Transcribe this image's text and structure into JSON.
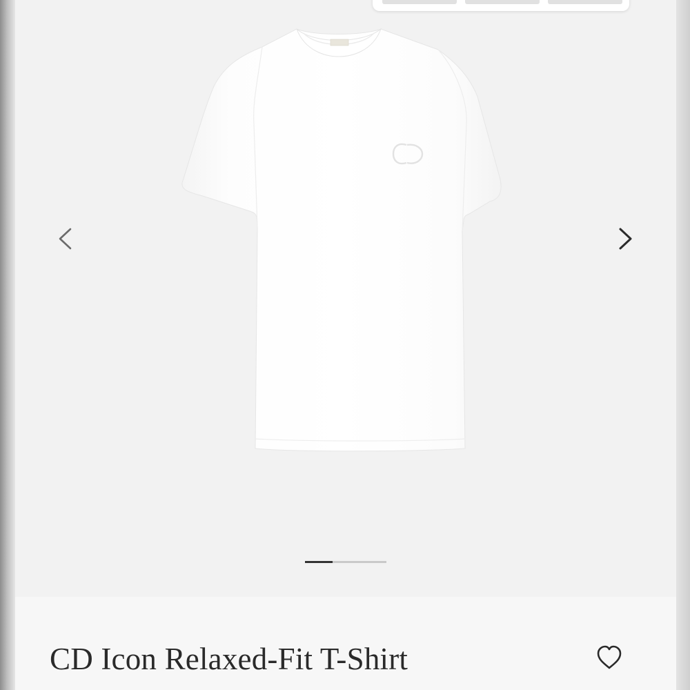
{
  "product": {
    "title": "CD Icon Relaxed-Fit T-Shirt",
    "image_icon": "white-tshirt-image",
    "logo_text": "CD"
  },
  "gallery": {
    "current_slide": 1,
    "total_slides": 3,
    "prev_icon": "chevron-left-icon",
    "next_icon": "chevron-right-icon"
  },
  "actions": {
    "wishlist_icon": "heart-icon"
  },
  "colors": {
    "background": "#f2f2f2",
    "text": "#2a2a2a",
    "indicator_active": "#333333",
    "indicator_inactive": "#c9c9c9"
  }
}
